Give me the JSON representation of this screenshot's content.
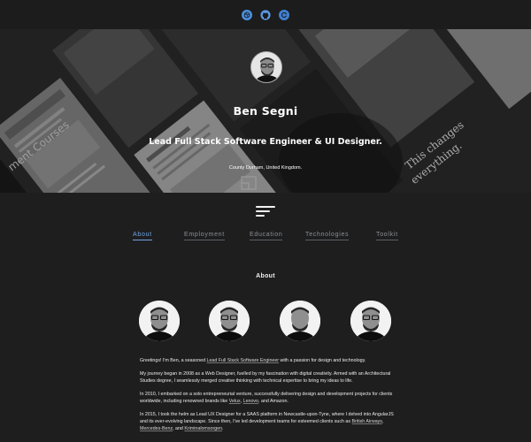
{
  "social": [
    {
      "name": "dribbble",
      "color": "#4a8fde"
    },
    {
      "name": "github",
      "color": "#5b9ae6"
    },
    {
      "name": "refresh",
      "color": "#3f7fd2"
    }
  ],
  "hero": {
    "name": "Ben Segni",
    "title": "Lead Full Stack Software Engineer & UI Designer.",
    "location": "County Durham, United Kingdom.",
    "bg_text_left": "ment Courses",
    "bg_text_right_1": "This changes",
    "bg_text_right_2": "everything."
  },
  "tabs": [
    {
      "label": "About",
      "active": true
    },
    {
      "label": "Employment",
      "active": false
    },
    {
      "label": "Education",
      "active": false
    },
    {
      "label": "Technologies",
      "active": false
    },
    {
      "label": "Toolkit",
      "active": false
    }
  ],
  "about": {
    "heading": "About",
    "p1_a": "Greetings! I'm Ben, a seasoned ",
    "p1_link": "Lead Full Stack Software Engineer",
    "p1_b": " with a passion for design and technology.",
    "p2": "My journey began in 2008 as a Web Designer, fuelled by my fascination with digital creativity. Armed with an Architectural Studies degree, I seamlessly merged creative thinking with technical expertise to bring my ideas to life.",
    "p3_a": "In 2010, I embarked on a solo entrepreneurial venture, successfully delivering design and development projects for clients worldwide, including renowned brands like ",
    "p3_link1": "Velux",
    "p3_sep": ", ",
    "p3_link2": "Lenovo",
    "p3_b": ", and Amazon.",
    "p4_a": "In 2015, I took the helm as Lead UX Designer for a SAAS platform in Newcastle-upon-Tyne, where I delved into AngularJS and its ever-evolving landscape. Since then, I've led development teams for esteemed clients such as ",
    "p4_link1": "British Airways",
    "p4_sep": ", ",
    "p4_link2": "Mercedes-Benz",
    "p4_and": ", and ",
    "p4_link3": "Kriminalomsorgen",
    "p4_end": "."
  }
}
